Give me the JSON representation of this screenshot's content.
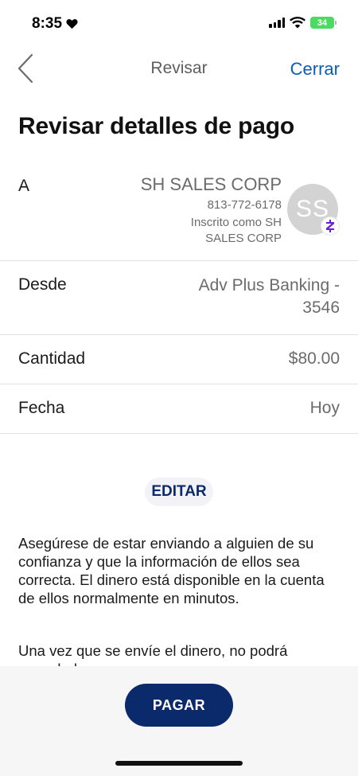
{
  "status_bar": {
    "time": "8:35",
    "battery": "34"
  },
  "nav": {
    "title": "Revisar",
    "close_label": "Cerrar"
  },
  "page_title": "Revisar detalles de pago",
  "recipient": {
    "label": "A",
    "name": "SH SALES CORP",
    "phone": "813-772-6178",
    "enrolled_line1": "Inscrito como SH",
    "enrolled_line2": "SALES CORP",
    "initials": "SS"
  },
  "details": {
    "from_label": "Desde",
    "from_value_line1": "Adv Plus Banking -",
    "from_value_line2": "3546",
    "amount_label": "Cantidad",
    "amount_value": "$80.00",
    "date_label": "Fecha",
    "date_value": "Hoy"
  },
  "edit_label": "EDITAR",
  "disclaimer": {
    "paragraph1": "Asegúrese de estar enviando a alguien de su confianza y que la información de ellos sea correcta. El dinero está disponible en la cuenta de ellos normalmente en minutos.",
    "paragraph2": "Una vez que se envíe el dinero, no podrá cancelarlo."
  },
  "pay_label": "PAGAR",
  "colors": {
    "accent_blue": "#0a5eb4",
    "navy": "#0b2a6b",
    "zelle_purple": "#6d1ed4"
  }
}
